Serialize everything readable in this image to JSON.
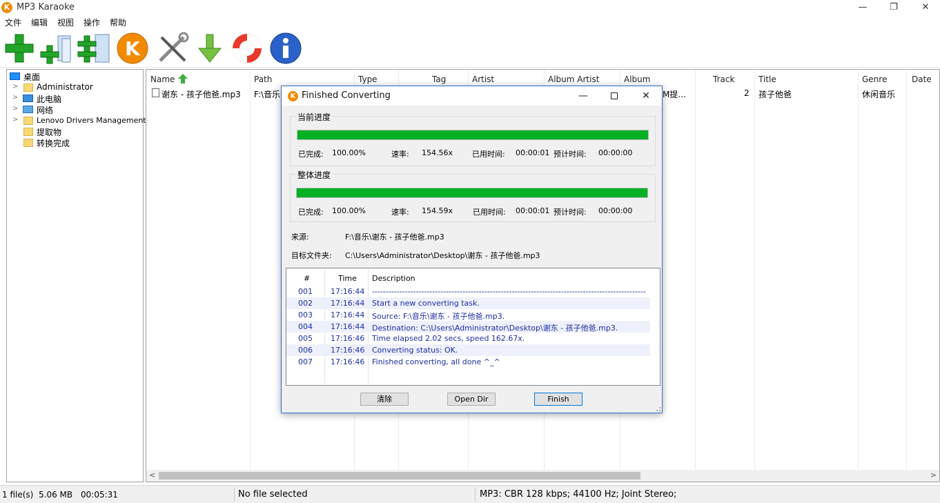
{
  "app": {
    "title": "MP3 Karaoke",
    "icon_letter": "K"
  },
  "window_controls": {
    "minimize": "—",
    "restore": "❐",
    "close": "✕"
  },
  "menu": [
    "文件",
    "编辑",
    "视图",
    "操作",
    "帮助"
  ],
  "toolbar": [
    "add-icon",
    "add-files-icon",
    "add-folder-icon",
    "karaoke-icon",
    "settings-icon",
    "download-icon",
    "help-icon",
    "info-icon"
  ],
  "tree": {
    "root": "桌面",
    "items": [
      "Administrator",
      "此电脑",
      "网络",
      "Lenovo Drivers Management",
      "提取物",
      "转换完成"
    ]
  },
  "list": {
    "columns": [
      "Name",
      "Path",
      "Type",
      "Tag",
      "Artist",
      "Album Artist",
      "Album",
      "Track",
      "Title",
      "Genre",
      "Date"
    ],
    "rows": [
      {
        "name": "谢东 - 孩子他爸.mp3",
        "path": "F:\\音乐",
        "album": "M提...",
        "track": "2",
        "title": "孩子他爸",
        "genre": "休闲音乐"
      }
    ]
  },
  "status": {
    "files": "1 file(s)",
    "size": "5.06 MB",
    "duration": "00:05:31",
    "selection": "No file selected",
    "format": "MP3:  CBR 128 kbps; 44100 Hz; Joint Stereo;"
  },
  "dialog": {
    "title": "Finished Converting",
    "current": {
      "label": "当前进度",
      "progress": 1.0,
      "done_label": "已完成:",
      "done_value": "100.00%",
      "speed_label": "速率:",
      "speed_value": "154.56x",
      "elapsed_label": "已用时间:",
      "elapsed_value": "00:00:01",
      "eta_label": "预计时间:",
      "eta_value": "00:00:00"
    },
    "overall": {
      "label": "整体进度",
      "progress": 1.0,
      "done_label": "已完成:",
      "done_value": "100.00%",
      "speed_label": "速率:",
      "speed_value": "154.59x",
      "elapsed_label": "已用时间:",
      "elapsed_value": "00:00:01",
      "eta_label": "预计时间:",
      "eta_value": "00:00:00"
    },
    "source_label": "来源:",
    "source_value": "F:\\音乐\\谢东 - 孩子他爸.mp3",
    "dest_label": "目标文件夹:",
    "dest_value": "C:\\Users\\Administrator\\Desktop\\谢东 - 孩子他爸.mp3",
    "log": {
      "headers": [
        "#",
        "Time",
        "Description"
      ],
      "rows": [
        {
          "n": "001",
          "time": "17:16:44",
          "desc": "-------------------------------------------------------------------------------------------------------------"
        },
        {
          "n": "002",
          "time": "17:16:44",
          "desc": "Start a new converting task."
        },
        {
          "n": "003",
          "time": "17:16:44",
          "desc": "Source:  F:\\音乐\\谢东 - 孩子他爸.mp3."
        },
        {
          "n": "004",
          "time": "17:16:44",
          "desc": "Destination: C:\\Users\\Administrator\\Desktop\\谢东 - 孩子他爸.mp3."
        },
        {
          "n": "005",
          "time": "17:16:46",
          "desc": "Time elapsed 2.02 secs, speed 162.67x."
        },
        {
          "n": "006",
          "time": "17:16:46",
          "desc": "Converting status: OK."
        },
        {
          "n": "007",
          "time": "17:16:46",
          "desc": "Finished converting, all done ^_^"
        }
      ]
    },
    "buttons": {
      "clear": "清除",
      "open_dir": "Open Dir",
      "finish": "Finish"
    }
  }
}
